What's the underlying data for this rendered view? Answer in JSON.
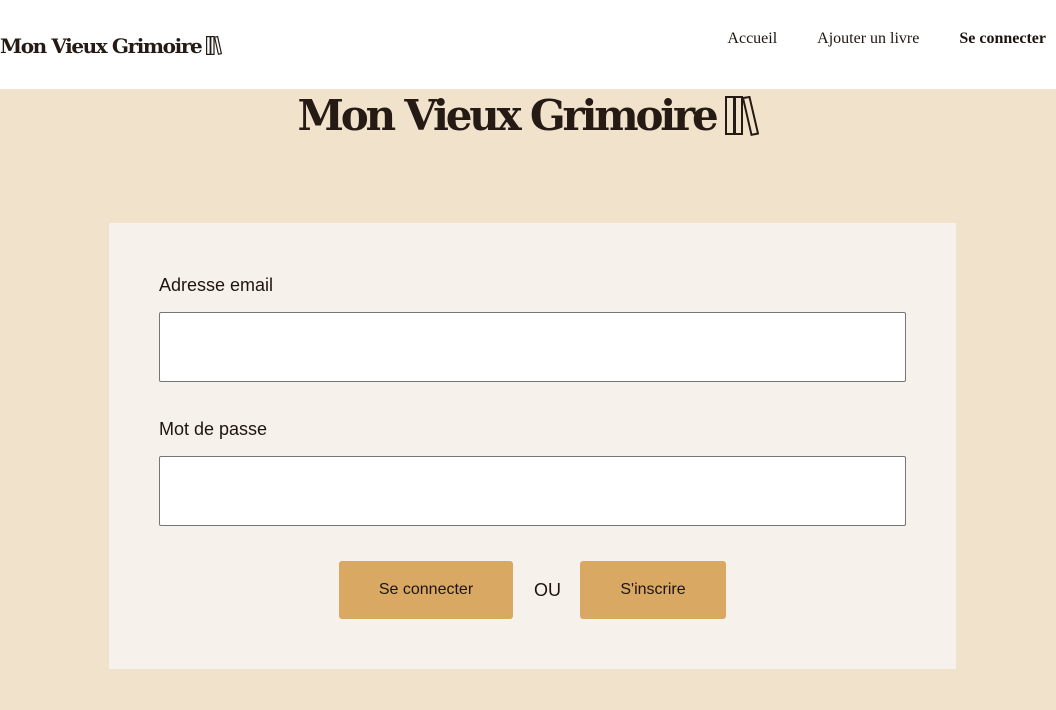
{
  "header": {
    "brand": "Mon Vieux Grimoire",
    "nav": {
      "home": "Accueil",
      "add_book": "Ajouter un livre",
      "login": "Se connecter"
    }
  },
  "hero": {
    "title": "Mon Vieux Grimoire"
  },
  "form": {
    "email_label": "Adresse email",
    "email_value": "",
    "password_label": "Mot de passe",
    "password_value": "",
    "login_button": "Se connecter",
    "or_text": "OU",
    "signup_button": "S'inscrire"
  },
  "colors": {
    "page_background": "#f1e2cc",
    "card_background": "#f7f1eb",
    "button": "#d9a862",
    "text": "#1c1410"
  },
  "icons": {
    "brand": "books-icon"
  }
}
